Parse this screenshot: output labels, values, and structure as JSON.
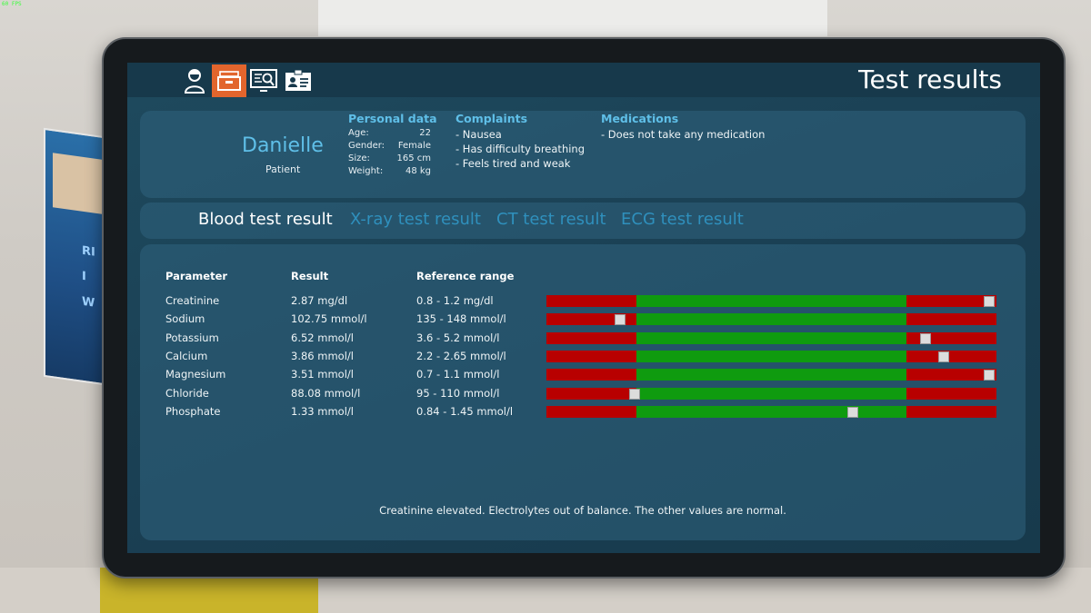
{
  "overlay": {
    "fps": "60 FPS"
  },
  "header": {
    "title": "Test results",
    "nav_icons": [
      "patient-icon",
      "records-drawer-icon",
      "monitor-search-icon",
      "id-card-icon"
    ],
    "active_icon": "records-drawer-icon",
    "accent_color": "#e2652d"
  },
  "patient": {
    "name": "Danielle",
    "role": "Patient",
    "personal_data": {
      "title": "Personal data",
      "rows": [
        {
          "label": "Age:",
          "value": "22"
        },
        {
          "label": "Gender:",
          "value": "Female"
        },
        {
          "label": "Size:",
          "value": "165 cm"
        },
        {
          "label": "Weight:",
          "value": "48 kg"
        }
      ]
    },
    "complaints": {
      "title": "Complaints",
      "items": [
        "- Nausea",
        "- Has difficulty breathing",
        "- Feels tired and weak"
      ]
    },
    "medications": {
      "title": "Medications",
      "items": [
        "- Does not take any medication"
      ]
    }
  },
  "tabs": [
    {
      "label": "Blood test result",
      "active": true
    },
    {
      "label": "X-ray test result",
      "active": false
    },
    {
      "label": "CT test result",
      "active": false
    },
    {
      "label": "ECG test result",
      "active": false
    }
  ],
  "results": {
    "headers": {
      "parameter": "Parameter",
      "result": "Result",
      "reference": "Reference range"
    },
    "rows": [
      {
        "parameter": "Creatinine",
        "result": "2.87  mg/dl",
        "reference": "0.8 - 1.2  mg/dl",
        "marker_fraction": 0.984
      },
      {
        "parameter": "Sodium",
        "result": "102.75  mmol/l",
        "reference": "135 - 148  mmol/l",
        "marker_fraction": 0.164
      },
      {
        "parameter": "Potassium",
        "result": "6.52  mmol/l",
        "reference": "3.6 - 5.2  mmol/l",
        "marker_fraction": 0.843
      },
      {
        "parameter": "Calcium",
        "result": "3.86  mmol/l",
        "reference": "2.2 - 2.65  mmol/l",
        "marker_fraction": 0.883
      },
      {
        "parameter": "Magnesium",
        "result": "3.51  mmol/l",
        "reference": "0.7 - 1.1  mmol/l",
        "marker_fraction": 0.984
      },
      {
        "parameter": "Chloride",
        "result": "88.08  mmol/l",
        "reference": "95 - 110  mmol/l",
        "marker_fraction": 0.196
      },
      {
        "parameter": "Phosphate",
        "result": "1.33  mmol/l",
        "reference": "0.84 - 1.45  mmol/l",
        "marker_fraction": 0.681
      }
    ],
    "range_bar": {
      "normal_band_fraction": [
        0.2,
        0.8
      ],
      "out_of_range_color": "#b80000",
      "normal_color": "#0f9b0f"
    },
    "summary": "Creatinine elevated. Electrolytes out of balance. The other values are normal."
  }
}
